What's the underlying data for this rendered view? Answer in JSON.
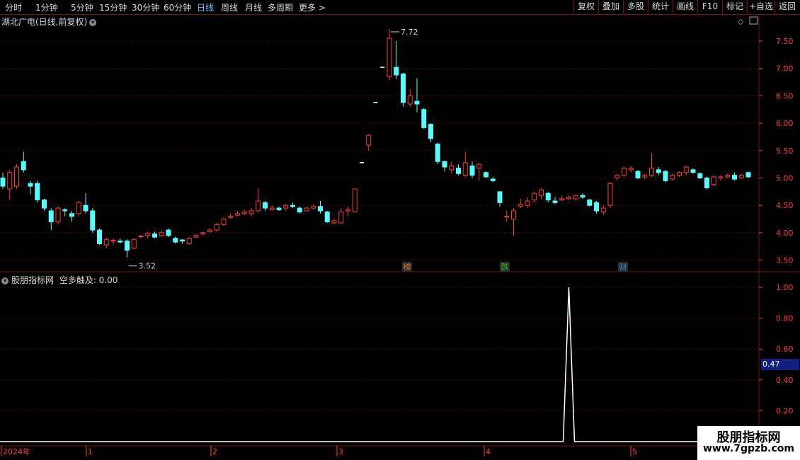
{
  "toolbar": {
    "periods": [
      "分时",
      "1分钟",
      "5分钟",
      "15分钟",
      "30分钟",
      "60分钟",
      "日线",
      "周线",
      "月线",
      "多周期",
      "更多 >"
    ],
    "active_period": "日线",
    "right_buttons": [
      "复权",
      "叠加",
      "多股",
      "统计",
      "画线",
      "F10",
      "标记",
      "+自选",
      "返回"
    ]
  },
  "main_chart": {
    "title": "湖北广电(日线,前复权)",
    "y_ticks": [
      "7.50",
      "7.00",
      "6.50",
      "6.00",
      "5.50",
      "5.00",
      "4.50",
      "4.00",
      "3.50"
    ],
    "high_marker": "7.72",
    "low_marker": "3.52",
    "event_tags": [
      {
        "label": "榜",
        "color": "#d07a30"
      },
      {
        "label": "跌",
        "color": "#30c030"
      },
      {
        "label": "财",
        "color": "#3090d0"
      }
    ]
  },
  "indicator": {
    "title": "股朋指标网",
    "series_label": "空多触及:",
    "series_value": "0.00",
    "y_ticks": [
      "1.00",
      "0.80",
      "0.60",
      "0.40",
      "0.20"
    ],
    "current_value": "0.47"
  },
  "x_axis": {
    "labels": [
      "2024年",
      "1",
      "2",
      "3",
      "4",
      "5"
    ]
  },
  "watermark": {
    "line1": "股朋指标网",
    "line2": "www.7gpzb.com"
  },
  "colors": {
    "up": "#ff3b3b",
    "down": "#54ffff",
    "grid": "#7a1010",
    "active_tab": "#5ac8ff"
  },
  "chart_data": {
    "type": "candlestick",
    "title": "湖北广电(日线,前复权)",
    "ylim": [
      3.35,
      7.85
    ],
    "candles": [
      [
        5.0,
        4.85,
        5.1,
        4.8
      ],
      [
        4.8,
        5.1,
        5.15,
        4.6
      ],
      [
        4.85,
        5.2,
        5.25,
        4.8
      ],
      [
        5.3,
        5.15,
        5.48,
        5.1
      ],
      [
        4.9,
        4.85,
        4.95,
        4.7
      ],
      [
        4.9,
        4.6,
        4.95,
        4.55
      ],
      [
        4.6,
        4.45,
        4.62,
        4.4
      ],
      [
        4.4,
        4.2,
        4.45,
        4.05
      ],
      [
        4.2,
        4.45,
        4.48,
        4.15
      ],
      [
        4.42,
        4.4,
        4.45,
        4.3
      ],
      [
        4.35,
        4.3,
        4.4,
        4.2
      ],
      [
        4.35,
        4.55,
        4.58,
        4.3
      ],
      [
        4.5,
        4.4,
        4.72,
        4.35
      ],
      [
        4.4,
        4.05,
        4.45,
        4.0
      ],
      [
        4.05,
        3.8,
        4.08,
        3.78
      ],
      [
        3.78,
        3.88,
        3.92,
        3.72
      ],
      [
        3.85,
        3.86,
        3.9,
        3.78
      ],
      [
        3.85,
        3.83,
        3.9,
        3.8
      ],
      [
        3.85,
        3.68,
        3.88,
        3.55
      ],
      [
        3.72,
        3.88,
        3.9,
        3.7
      ],
      [
        3.93,
        3.94,
        3.96,
        3.9
      ],
      [
        3.95,
        3.99,
        4.02,
        3.9
      ],
      [
        3.98,
        3.92,
        4.02,
        3.9
      ],
      [
        3.95,
        4.0,
        4.05,
        3.92
      ],
      [
        4.05,
        3.95,
        4.08,
        3.92
      ],
      [
        3.9,
        3.83,
        3.93,
        3.8
      ],
      [
        3.87,
        3.85,
        3.88,
        3.8
      ],
      [
        3.8,
        3.9,
        3.92,
        3.78
      ],
      [
        3.92,
        3.95,
        3.98,
        3.9
      ],
      [
        3.98,
        4.0,
        4.02,
        3.95
      ],
      [
        4.02,
        4.05,
        4.08,
        4.0
      ],
      [
        4.05,
        4.15,
        4.18,
        4.02
      ],
      [
        4.15,
        4.25,
        4.28,
        4.12
      ],
      [
        4.28,
        4.3,
        4.35,
        4.25
      ],
      [
        4.32,
        4.35,
        4.4,
        4.3
      ],
      [
        4.35,
        4.38,
        4.42,
        4.32
      ],
      [
        4.35,
        4.4,
        4.45,
        4.3
      ],
      [
        4.4,
        4.58,
        4.82,
        4.38
      ],
      [
        4.55,
        4.45,
        4.58,
        4.4
      ],
      [
        4.42,
        4.45,
        4.5,
        4.4
      ],
      [
        4.45,
        4.42,
        4.48,
        4.4
      ],
      [
        4.45,
        4.5,
        4.52,
        4.4
      ],
      [
        4.5,
        4.48,
        4.55,
        4.45
      ],
      [
        4.45,
        4.38,
        4.48,
        4.35
      ],
      [
        4.4,
        4.45,
        4.48,
        4.38
      ],
      [
        4.45,
        4.48,
        4.52,
        4.42
      ],
      [
        4.48,
        4.4,
        4.58,
        4.35
      ],
      [
        4.38,
        4.2,
        4.4,
        4.18
      ],
      [
        4.18,
        4.22,
        4.25,
        4.15
      ],
      [
        4.18,
        4.38,
        4.45,
        4.15
      ],
      [
        4.4,
        4.42,
        4.48,
        4.3
      ],
      [
        4.38,
        4.8,
        4.8,
        4.38
      ],
      [
        5.28,
        5.28,
        5.28,
        5.28
      ],
      [
        5.6,
        5.78,
        5.8,
        5.5
      ],
      [
        6.38,
        6.38,
        6.38,
        6.38
      ],
      [
        7.02,
        7.02,
        7.02,
        7.02
      ],
      [
        6.85,
        7.55,
        7.72,
        6.78
      ],
      [
        7.02,
        6.88,
        7.5,
        6.8
      ],
      [
        6.9,
        6.38,
        6.92,
        6.3
      ],
      [
        6.35,
        6.5,
        6.62,
        6.3
      ],
      [
        6.4,
        6.35,
        6.82,
        6.2
      ],
      [
        6.25,
        5.92,
        6.28,
        5.9
      ],
      [
        5.98,
        5.72,
        6.0,
        5.65
      ],
      [
        5.62,
        5.3,
        5.65,
        5.25
      ],
      [
        5.3,
        5.2,
        5.32,
        5.12
      ],
      [
        5.15,
        5.22,
        5.3,
        5.08
      ],
      [
        5.18,
        5.08,
        5.25,
        5.05
      ],
      [
        5.05,
        5.28,
        5.48,
        5.02
      ],
      [
        5.22,
        5.05,
        5.3,
        5.0
      ],
      [
        5.18,
        5.25,
        5.28,
        4.95
      ],
      [
        5.1,
        5.02,
        5.12,
        5.0
      ],
      [
        4.98,
        4.95,
        5.02,
        4.92
      ],
      [
        4.75,
        4.55,
        4.75,
        4.48
      ],
      [
        4.3,
        4.3,
        4.4,
        4.2
      ],
      [
        4.25,
        4.4,
        4.45,
        3.95
      ],
      [
        4.48,
        4.52,
        4.62,
        4.45
      ],
      [
        4.5,
        4.58,
        4.65,
        4.45
      ],
      [
        4.6,
        4.72,
        4.75,
        4.55
      ],
      [
        4.68,
        4.78,
        4.82,
        4.62
      ],
      [
        4.72,
        4.6,
        4.75,
        4.55
      ],
      [
        4.58,
        4.55,
        4.65,
        4.52
      ],
      [
        4.6,
        4.62,
        4.68,
        4.58
      ],
      [
        4.62,
        4.65,
        4.68,
        4.6
      ],
      [
        4.62,
        4.68,
        4.7,
        4.58
      ],
      [
        4.68,
        4.65,
        4.72,
        4.62
      ],
      [
        4.6,
        4.5,
        4.62,
        4.48
      ],
      [
        4.55,
        4.4,
        4.58,
        4.35
      ],
      [
        4.38,
        4.45,
        4.5,
        4.32
      ],
      [
        4.5,
        4.9,
        4.92,
        4.45
      ],
      [
        5.0,
        5.05,
        5.08,
        4.95
      ],
      [
        5.05,
        5.18,
        5.2,
        5.02
      ],
      [
        5.15,
        5.18,
        5.22,
        5.1
      ],
      [
        5.12,
        5.0,
        5.15,
        4.98
      ],
      [
        5.02,
        5.05,
        5.08,
        4.98
      ],
      [
        5.05,
        5.18,
        5.45,
        5.02
      ],
      [
        5.15,
        5.1,
        5.2,
        5.05
      ],
      [
        5.12,
        4.95,
        5.15,
        4.92
      ],
      [
        4.98,
        5.05,
        5.08,
        4.95
      ],
      [
        5.05,
        5.1,
        5.12,
        5.02
      ],
      [
        5.1,
        5.2,
        5.22,
        5.05
      ],
      [
        5.15,
        5.1,
        5.18,
        5.08
      ],
      [
        5.08,
        5.0,
        5.1,
        4.98
      ],
      [
        5.0,
        4.82,
        5.02,
        4.8
      ],
      [
        4.88,
        5.02,
        5.05,
        4.85
      ],
      [
        5.0,
        5.02,
        5.05,
        4.95
      ],
      [
        5.02,
        5.05,
        5.08,
        5.0
      ],
      [
        5.05,
        4.98,
        5.1,
        4.95
      ],
      [
        5.0,
        5.05,
        5.08,
        4.98
      ],
      [
        5.1,
        5.02,
        5.12,
        5.0
      ]
    ],
    "indicator_series": {
      "name": "空多触及",
      "ylim": [
        0,
        1.0
      ],
      "spike_at_candle": 82,
      "spike_value": 1.0
    }
  }
}
